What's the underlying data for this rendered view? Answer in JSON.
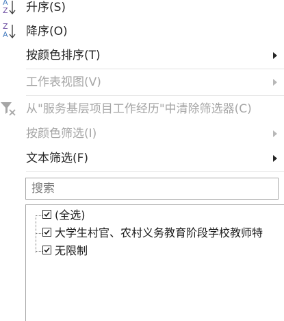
{
  "menu": {
    "sort_asc": "升序(S)",
    "sort_desc": "降序(O)",
    "sort_by_color": "按颜色排序(T)",
    "sheet_view": "工作表视图(V)",
    "clear_filter": "从\"服务基层项目工作经历\"中清除筛选器(C)",
    "filter_by_color": "按颜色筛选(I)",
    "text_filter": "文本筛选(F)"
  },
  "icons": {
    "sort_asc_letters": [
      "A",
      "Z"
    ],
    "sort_desc_letters": [
      "Z",
      "A"
    ],
    "sort_letter_colors": [
      "#4a7fc1",
      "#6a4aa0"
    ]
  },
  "search": {
    "placeholder": "搜索"
  },
  "tree": {
    "items": [
      {
        "label": "(全选)",
        "checked": true
      },
      {
        "label": "大学生村官、农村义务教育阶段学校教师特",
        "checked": true
      },
      {
        "label": "无限制",
        "checked": true
      }
    ]
  }
}
